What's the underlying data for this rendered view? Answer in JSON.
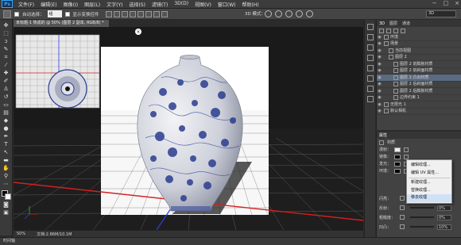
{
  "app": {
    "logo": "Ps"
  },
  "menu": [
    "文件(F)",
    "编辑(E)",
    "图像(I)",
    "图层(L)",
    "文字(Y)",
    "选择(S)",
    "滤镜(T)",
    "3D(D)",
    "视图(V)",
    "窗口(W)",
    "帮助(H)"
  ],
  "window_controls": [
    "−",
    "□",
    "×"
  ],
  "options": {
    "auto_select_label": "自动选择：",
    "auto_select_value": "组",
    "show_transform_label": "显示变换控件",
    "mode_label": "3D 模式：",
    "workspace": "3D"
  },
  "document": {
    "tab_title": "未标题-1 热成的 @ 50% (图层 2 副本, RGB/8) *",
    "zoom": "50%",
    "doc_info": "文档:2.86M/10.1M"
  },
  "bottom_tab": "时间轴",
  "scene_panel": {
    "tabs": [
      "3D",
      "图层",
      "通道"
    ],
    "items": [
      {
        "label": "环境",
        "indent": 0,
        "selected": false
      },
      {
        "label": "场景",
        "indent": 0,
        "selected": false
      },
      {
        "label": "当前视图",
        "indent": 1,
        "selected": false
      },
      {
        "label": "图层 2",
        "indent": 1,
        "selected": false
      },
      {
        "label": "图层 2 前膨胀材质",
        "indent": 2,
        "selected": false
      },
      {
        "label": "图层 2 前斜面材质",
        "indent": 2,
        "selected": false
      },
      {
        "label": "图层 2 凸出材质",
        "indent": 2,
        "selected": true
      },
      {
        "label": "图层 2 后斜面材质",
        "indent": 2,
        "selected": false
      },
      {
        "label": "图层 2 后膨胀材质",
        "indent": 2,
        "selected": false
      },
      {
        "label": "边界约束 1",
        "indent": 2,
        "selected": false
      },
      {
        "label": "无限光 1",
        "indent": 0,
        "selected": false
      },
      {
        "label": "默认相机",
        "indent": 0,
        "selected": false
      }
    ]
  },
  "props_panel": {
    "tabs": [
      "属性"
    ],
    "material_label": "材质",
    "rows": [
      {
        "label": "漫射："
      },
      {
        "label": "镜像："
      },
      {
        "label": "发光："
      },
      {
        "label": "环境："
      }
    ],
    "lower_rows": [
      {
        "label": "闪亮：",
        "value": "0%"
      },
      {
        "label": "反射：",
        "value": "0%"
      },
      {
        "label": "粗糙度：",
        "value": "0%"
      },
      {
        "label": "凹凸：",
        "value": "10%"
      }
    ]
  },
  "context_menu": [
    {
      "label": "编辑纹理...",
      "hover": false
    },
    {
      "label": "编辑 UV 属性...",
      "hover": false
    },
    {
      "sep": true
    },
    {
      "label": "新建纹理...",
      "hover": false
    },
    {
      "label": "替换纹理...",
      "hover": false
    },
    {
      "label": "移去纹理",
      "hover": true
    }
  ],
  "colors": {
    "accent": "#31a8ff",
    "selection": "#5a6a80",
    "grid_red": "#d42020",
    "vase_blue": "#2b3d8f"
  }
}
